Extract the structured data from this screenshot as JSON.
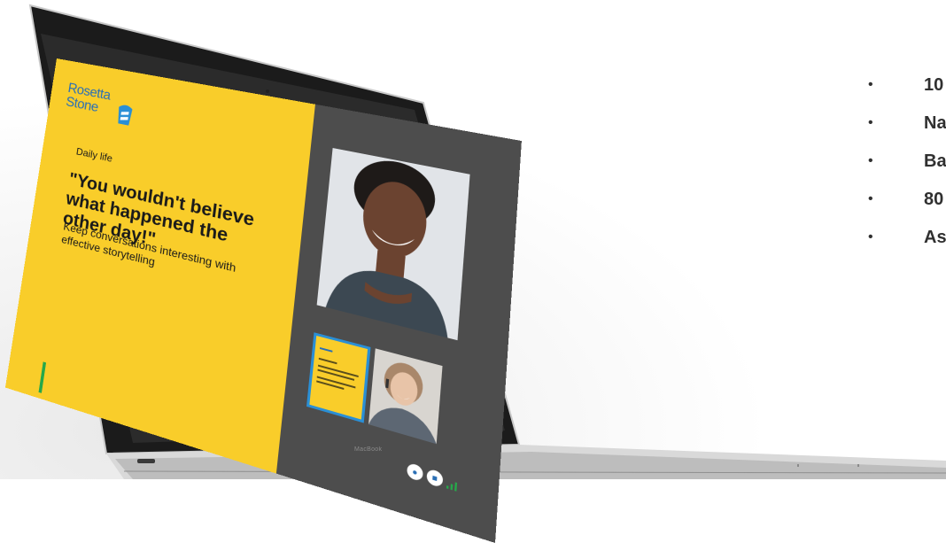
{
  "laptop": {
    "brand": "MacBook"
  },
  "slide": {
    "logo_line1": "Rosetta",
    "logo_line2": "Stone",
    "topic": "Daily life",
    "quote": "\"You wouldn't believe what happened the other day!\"",
    "subtitle": "Keep conversations interesting with effective storytelling"
  },
  "video_call": {
    "controls": [
      "mic-icon",
      "camera-icon"
    ],
    "signal_icon": "signal-icon"
  },
  "bullets": [
    {
      "marker": "•",
      "text": "10"
    },
    {
      "marker": "•",
      "text": "Na"
    },
    {
      "marker": "•",
      "text": "Ba"
    },
    {
      "marker": "•",
      "text": "80"
    },
    {
      "marker": "•",
      "text": "As"
    }
  ],
  "colors": {
    "slide_bg": "#f9cd2a",
    "screen_bg": "#4d4d4d",
    "brand_blue": "#2a6fb5",
    "accent_green": "#26a84a"
  }
}
